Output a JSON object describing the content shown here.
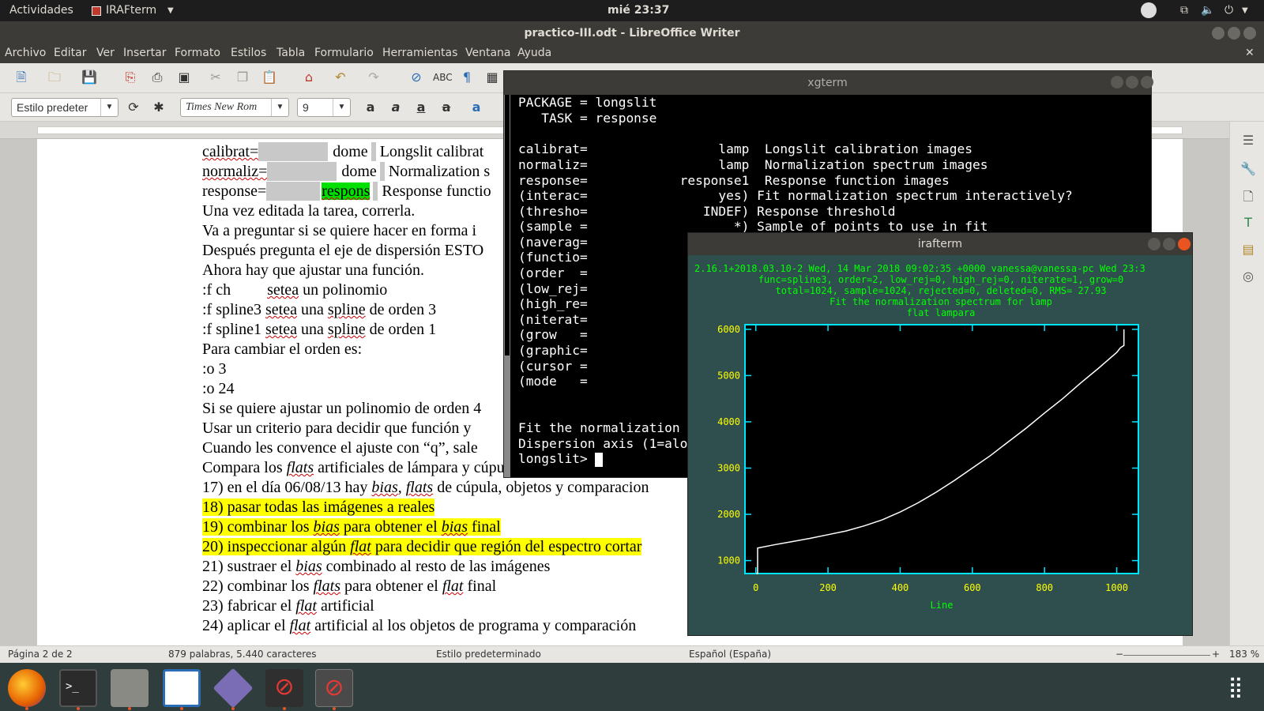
{
  "topbar": {
    "activities": "Actividades",
    "app": "IRAFterm",
    "clock": "mié 23:37"
  },
  "writer": {
    "title": "practico-III.odt - LibreOffice Writer",
    "menu": [
      "Archivo",
      "Editar",
      "Ver",
      "Insertar",
      "Formato",
      "Estilos",
      "Tabla",
      "Formulario",
      "Herramientas",
      "Ventana",
      "Ayuda"
    ],
    "para_style": "Estilo predeter",
    "font_name": "Times New Rom",
    "font_size": "9",
    "doc": {
      "l1a": "calibrat=",
      "l1b": "dome",
      "l1c": "Longslit calibrat",
      "l2a": "normaliz=",
      "l2b": "dome",
      "l2c": "Normalization s",
      "l3a": "response=",
      "l3b": "respons",
      "l3c": "Response functio",
      "l4": "Una vez editada la tarea, correrla.",
      "l5": "Va a preguntar si se quiere hacer en forma i",
      "l6": "Después pregunta el eje de dispersión ESTO",
      "l7": "Ahora hay que ajustar una función.",
      "l8a": ":f ch",
      "l8b": "setea",
      "l8c": " un polinomio",
      "l9a": ":f spline3 ",
      "l9b": "setea",
      "l9c": " una ",
      "l9d": "spline",
      "l9e": " de orden 3",
      "l10a": ":f spline1 ",
      "l10b": "setea",
      "l10c": " una ",
      "l10d": "spline",
      "l10e": " de orden 1",
      "l11": "Para cambiar el orden es:",
      "l12": ":o 3",
      "l13": ":o 24",
      "l14": "Si se quiere ajustar un polinomio de orden 4",
      "l15": "Usar un criterio para decidir que función y",
      "l16": "Cuando les convence el ajuste con “q”, sale",
      "l17a": "Compara los ",
      "l17b": "flats",
      "l17c": " artificiales de lámpara y cúpula, cuál elegir? Porque",
      "l18a": "17) en el día 06/08/13 hay ",
      "l18b": "bias",
      "l18c": ", ",
      "l18d": "flats",
      "l18e": " de cúpula, objetos y comparacion",
      "l19": "18) pasar todas las imágenes a reales",
      "l20a": "19) combinar los ",
      "l20b": "bias",
      "l20c": " para obtener el ",
      "l20d": "bias",
      "l20e": " final",
      "l21a": "20) inspeccionar algún ",
      "l21b": "flat",
      "l21c": " para decidir que región del espectro cortar",
      "l22a": "21) sustraer el ",
      "l22b": "bias",
      "l22c": " combinado al resto de las imágenes",
      "l23a": "22) combinar los ",
      "l23b": "flats",
      "l23c": " para obtener el ",
      "l23d": "flat",
      "l23e": " final",
      "l24a": "23) fabricar el ",
      "l24b": "flat",
      "l24c": " artificial",
      "l25a": "24) aplicar el ",
      "l25b": "flat",
      "l25c": " artificial al los objetos de programa y comparación"
    },
    "status": {
      "page": "Página 2 de 2",
      "words": "879 palabras, 5.440 caracteres",
      "style": "Estilo predeterminado",
      "lang": "Español (España)",
      "zoom": "183 %"
    }
  },
  "xgterm": {
    "title": "xgterm",
    "lines": [
      "PACKAGE = longslit",
      "   TASK = response",
      "",
      "calibrat=                 lamp  Longslit calibration images",
      "normaliz=                 lamp  Normalization spectrum images",
      "response=            response1  Response function images",
      "(interac=                 yes) Fit normalization spectrum interactively?",
      "(thresho=               INDEF) Response threshold",
      "(sample =                   *) Sample of points to use in fit",
      "(naverag=",
      "(functio=",
      "(order  =",
      "(low_rej=",
      "(high_re=",
      "(niterat=",
      "(grow   =",
      "(graphic=",
      "(cursor =",
      "(mode   =",
      "",
      "",
      "Fit the normalization",
      "Dispersion axis (1=alo",
      "longslit> "
    ]
  },
  "irafterm": {
    "title": "irafterm",
    "header": [
      "2.16.1+2018.03.10-2 Wed, 14 Mar 2018 09:02:35 +0000 vanessa@vanessa-pc Wed 23:3",
      "func=spline3, order=2, low_rej=0, high_rej=0, niterate=1, grow=0",
      "total=1024, sample=1024, rejected=0, deleted=0, RMS=  27.93",
      "Fit the normalization spectrum for lamp",
      "flat lampara"
    ]
  },
  "chart_data": {
    "type": "line",
    "title": "Fit the normalization spectrum for lamp",
    "subtitle": "flat lampara",
    "xlabel": "Line",
    "ylabel": "",
    "xlim": [
      -30,
      1060
    ],
    "ylim": [
      720,
      6100
    ],
    "xticks": [
      0,
      200,
      400,
      600,
      800,
      1000
    ],
    "yticks": [
      1000,
      2000,
      3000,
      4000,
      5000,
      6000
    ],
    "series": [
      {
        "x": [
          1,
          5,
          5,
          50,
          100,
          150,
          200,
          250,
          300,
          350,
          400,
          450,
          500,
          550,
          600,
          650,
          700,
          750,
          800,
          850,
          900,
          950,
          1000,
          1010,
          1020,
          1020
        ],
        "values": [
          720,
          720,
          1270,
          1340,
          1410,
          1480,
          1560,
          1640,
          1750,
          1880,
          2050,
          2250,
          2480,
          2730,
          3000,
          3270,
          3570,
          3870,
          4190,
          4500,
          4840,
          5160,
          5500,
          5600,
          5650,
          6000
        ]
      }
    ],
    "colors": {
      "axes": "#00e5ff",
      "ticks_text": "#ffff00",
      "curve": "#ffffff",
      "header_text": "#00ff00"
    }
  }
}
